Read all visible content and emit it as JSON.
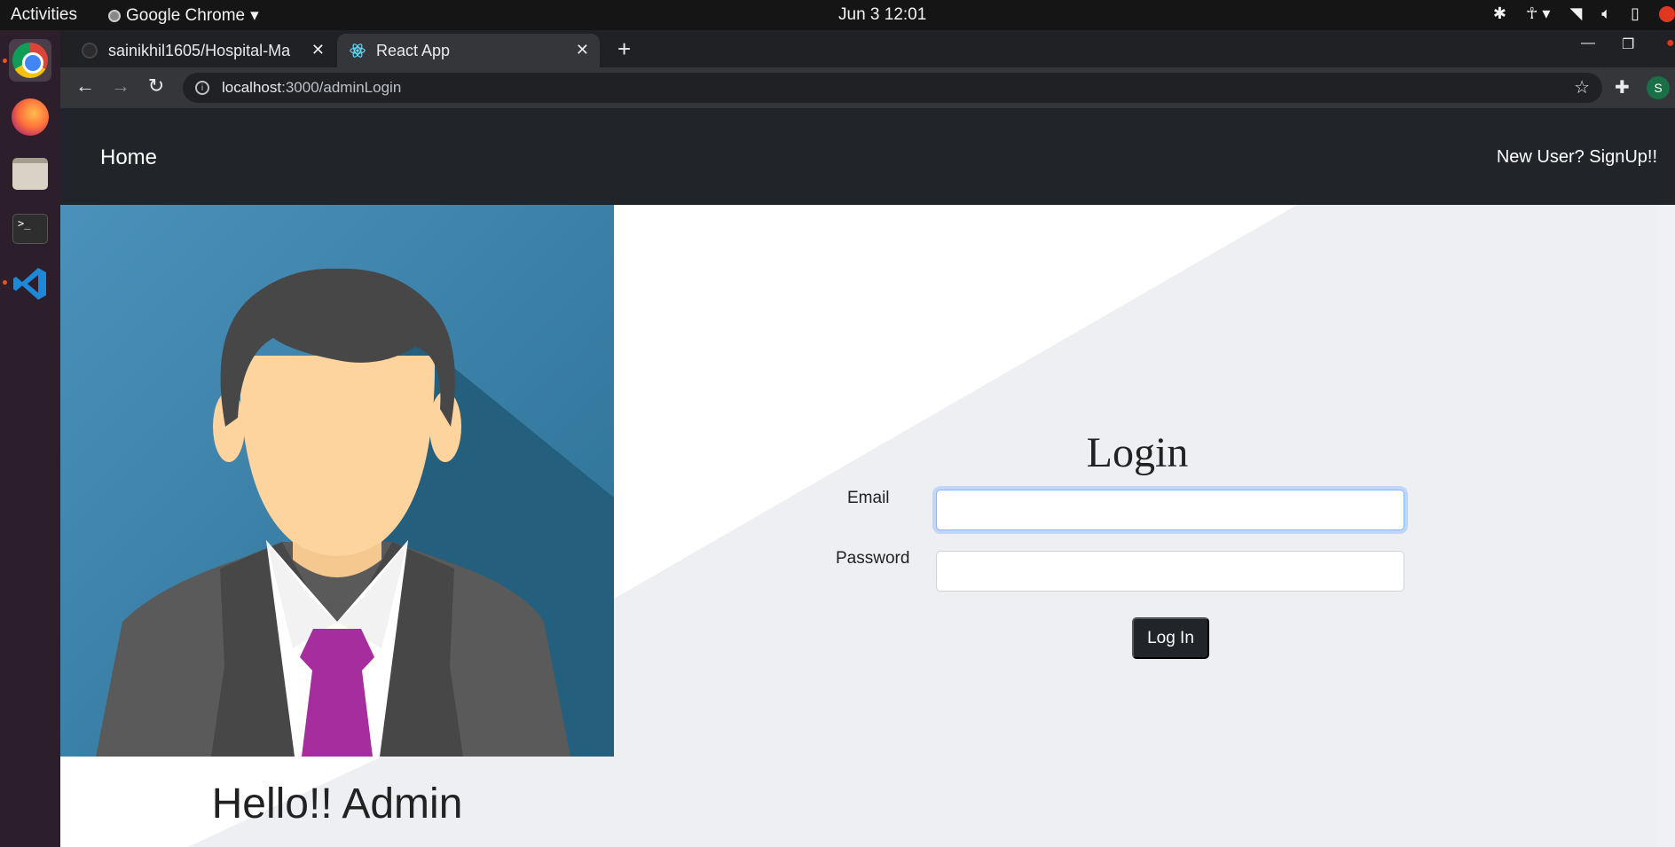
{
  "os_topbar": {
    "activities": "Activities",
    "app_name": "Google Chrome",
    "clock": "Jun 3  12:01"
  },
  "dock": {
    "apps": [
      "chrome-icon",
      "firefox-icon",
      "files-icon",
      "terminal-icon",
      "vscode-icon"
    ],
    "terminal_glyph": ">_"
  },
  "browser": {
    "tabs": [
      {
        "title": "sainikhil1605/Hospital-Ma",
        "active": false
      },
      {
        "title": "React App",
        "active": true
      }
    ],
    "url_host": "localhost",
    "url_path": ":3000/adminLogin",
    "profile_initial": "S"
  },
  "page": {
    "navbar": {
      "brand": "Home",
      "signup_link": "New User? SignUp!!"
    },
    "left": {
      "greeting": "Hello!! Admin"
    },
    "login": {
      "title": "Login",
      "email_label": "Email",
      "email_value": "",
      "password_label": "Password",
      "password_value": "",
      "submit_label": "Log In"
    }
  },
  "colors": {
    "navbar_bg": "#212529",
    "portrait_bg": "#3d86ad",
    "tie": "#a52d9e",
    "panel_gray": "#eeeff3",
    "focus_ring": "#c2d6fb"
  }
}
